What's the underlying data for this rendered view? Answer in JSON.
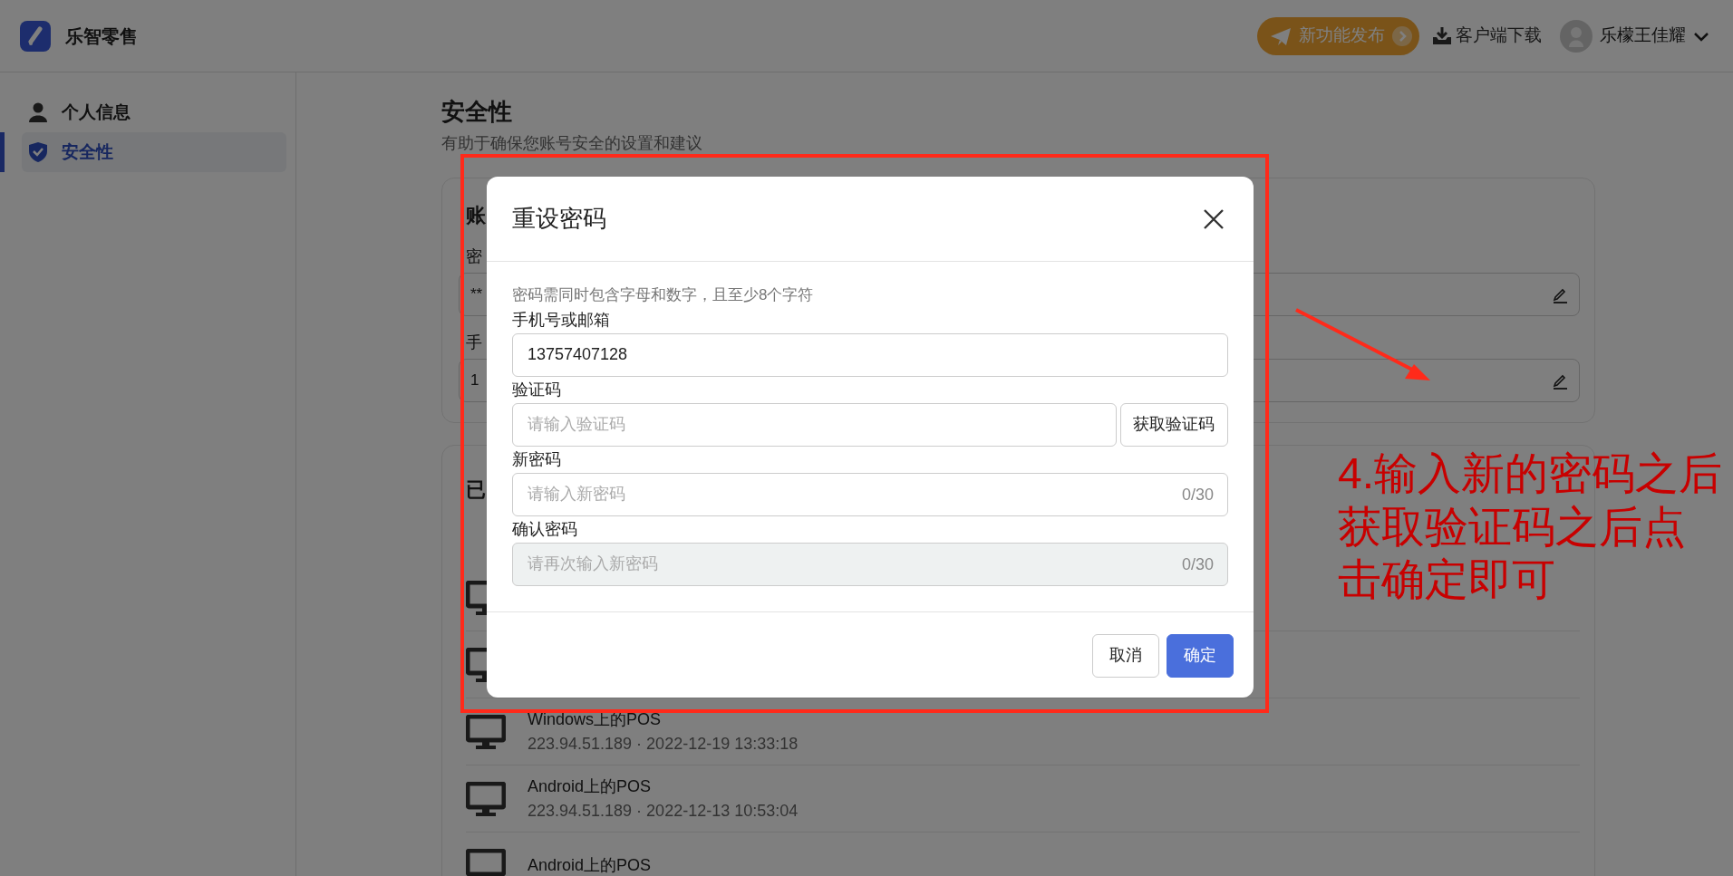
{
  "app": {
    "name": "乐智零售"
  },
  "header": {
    "whats_new": "新功能发布",
    "download": "客户端下载",
    "user": "乐檬王佳耀"
  },
  "sidebar": {
    "items": [
      {
        "label": "个人信息",
        "selected": false
      },
      {
        "label": "安全性",
        "selected": true
      }
    ]
  },
  "page": {
    "title": "安全性",
    "subtitle": "有助于确保您账号安全的设置和建议"
  },
  "account_card": {
    "title": "账",
    "fields": [
      {
        "label": "密",
        "value": "**"
      },
      {
        "label": "手",
        "value": "1"
      }
    ]
  },
  "devices_card": {
    "title": "已",
    "devices": [
      {
        "kind": "covered"
      },
      {
        "kind": "covered"
      },
      {
        "kind": "entry",
        "name": "Windows上的POS",
        "detail": "223.94.51.189 · 2022-12-19 13:33:18"
      },
      {
        "kind": "entry",
        "name": "Android上的POS",
        "detail": "223.94.51.189 · 2022-12-13 10:53:04"
      },
      {
        "kind": "entry",
        "name": "Android上的POS"
      }
    ]
  },
  "dialog": {
    "title": "重设密码",
    "hint": "密码需同时包含字母和数字，且至少8个字符",
    "fields": [
      {
        "kind": "text",
        "label": "手机号或邮箱",
        "value": "13757407128",
        "disabled": false
      },
      {
        "kind": "code",
        "label": "验证码",
        "placeholder": "请输入验证码",
        "button": "获取验证码",
        "disabled": false
      },
      {
        "kind": "password",
        "label": "新密码",
        "placeholder": "请输入新密码",
        "counter": "0/30",
        "disabled": false
      },
      {
        "kind": "password",
        "label": "确认密码",
        "placeholder": "请再次输入新密码",
        "counter": "0/30",
        "disabled": true
      }
    ],
    "buttons": [
      {
        "label": "取消",
        "primary": false
      },
      {
        "label": "确定",
        "primary": true
      }
    ]
  },
  "annotation": {
    "lines": [
      "4.输入新的密码之后",
      "获取验证码之后点",
      "击确定即可"
    ]
  }
}
